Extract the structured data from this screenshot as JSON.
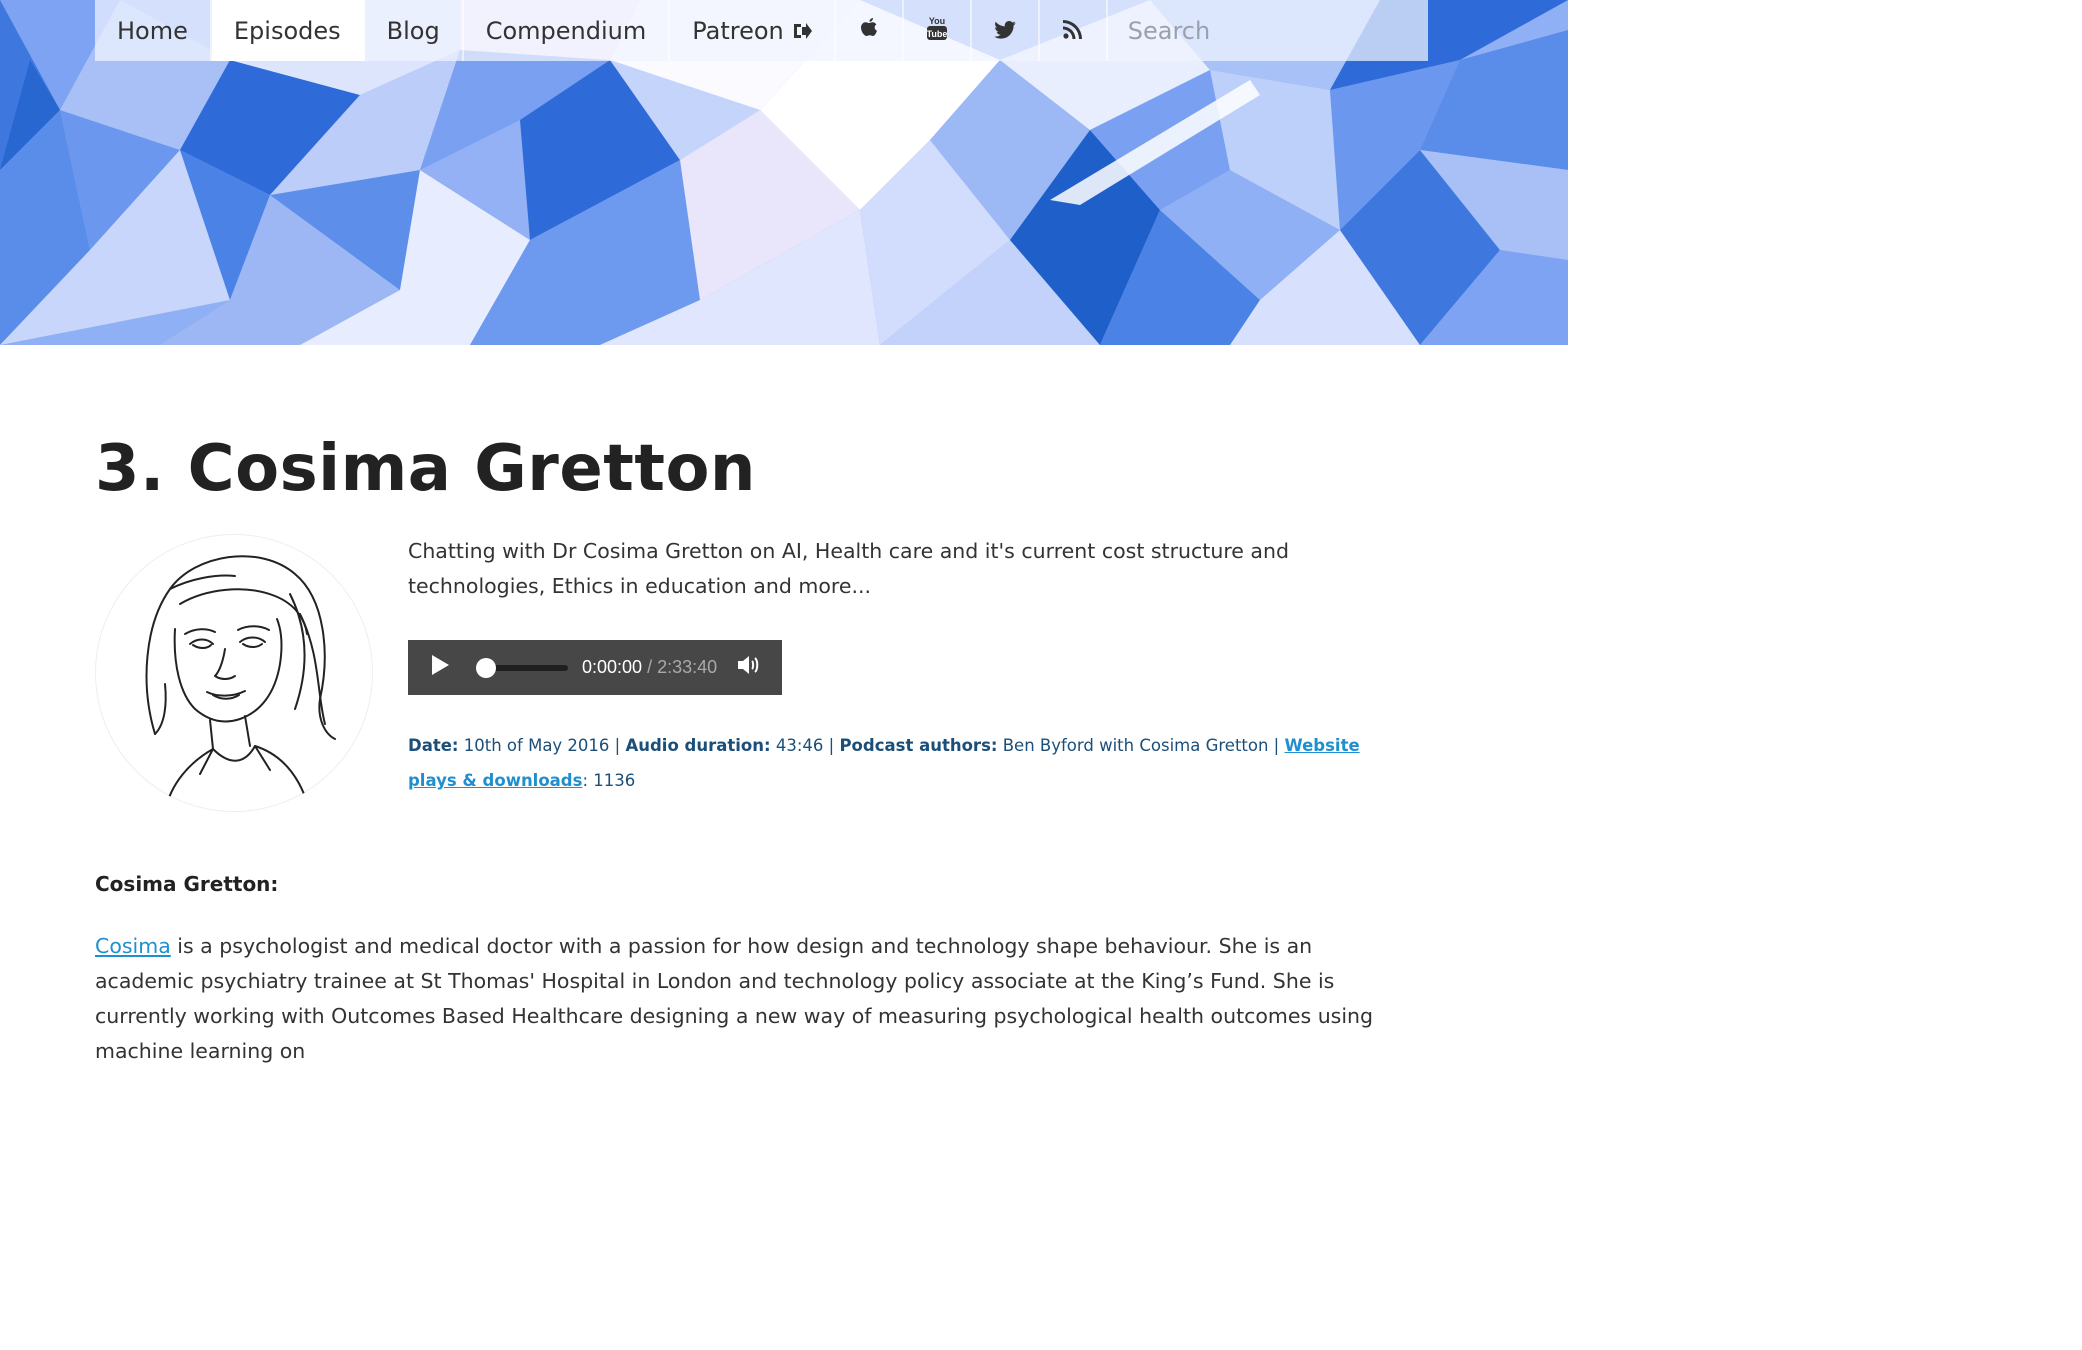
{
  "nav": {
    "items": [
      {
        "label": "Home",
        "active": false
      },
      {
        "label": "Episodes",
        "active": true
      },
      {
        "label": "Blog",
        "active": false
      },
      {
        "label": "Compendium",
        "active": false
      },
      {
        "label": "Patreon",
        "active": false
      }
    ],
    "icons": [
      "apple-icon",
      "youtube-icon",
      "twitter-icon",
      "rss-icon"
    ],
    "youtube_text_top": "You",
    "youtube_text_bottom": "Tube",
    "search_placeholder": "Search"
  },
  "episode": {
    "title": "3. Cosima Gretton",
    "description": "Chatting with Dr Cosima Gretton on AI, Health care and it's current cost structure and technologies, Ethics in education and more...",
    "player": {
      "current_time": "0:00:00",
      "separator": " / ",
      "total_time": "2:33:40",
      "progress": 0
    },
    "meta": {
      "date_label": "Date:",
      "date_value": " 10th of May 2016 | ",
      "duration_label": "Audio duration:",
      "duration_value": " 43:46 | ",
      "authors_label": "Podcast authors:",
      "authors_value": " Ben Byford with Cosima Gretton | ",
      "plays_link": "Website plays & downloads",
      "plays_value": ": 1136"
    }
  },
  "guest": {
    "heading": "Cosima Gretton:",
    "link_text": "Cosima",
    "bio": " is a psychologist and medical doctor with a passion for how design and technology shape behaviour. She is an academic psychiatry trainee at St Thomas' Hospital in London and technology policy associate at the King’s Fund. She is currently working with Outcomes Based Healthcare designing a new way of measuring psychological health outcomes using machine learning on"
  },
  "colors": {
    "accent": "#1f8fd0",
    "meta_text": "#1b4f7a",
    "player_bg": "#474747",
    "hero_base": "#8fb0f4"
  }
}
